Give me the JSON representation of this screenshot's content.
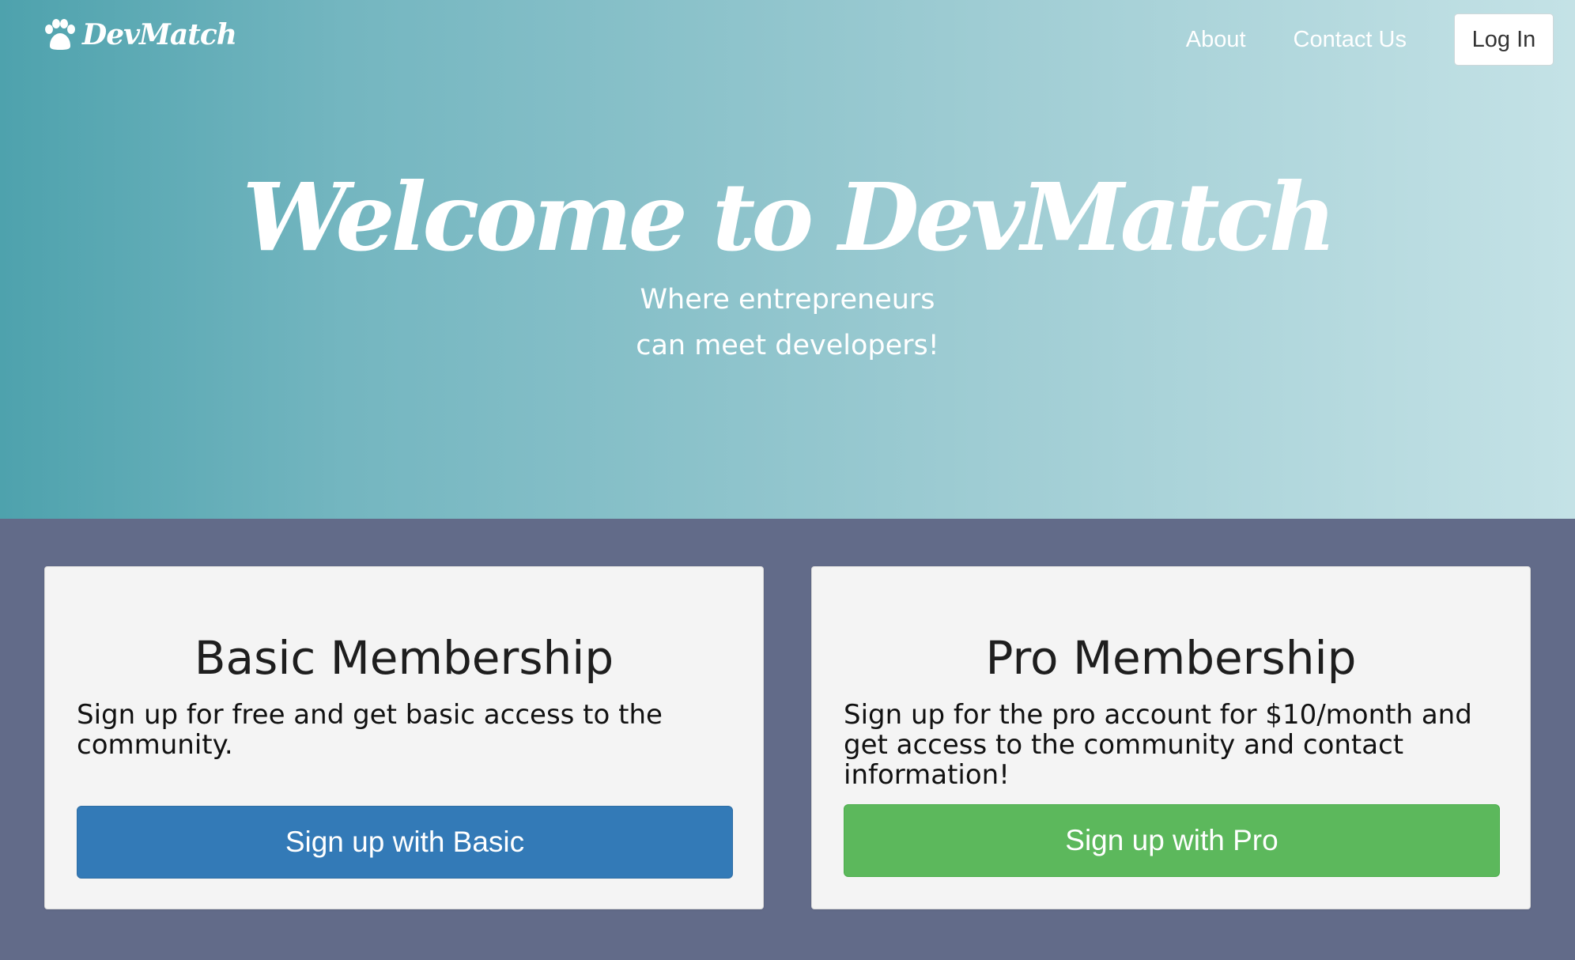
{
  "navbar": {
    "brand": "DevMatch",
    "brand_icon": "paw-icon",
    "links": [
      "About",
      "Contact Us"
    ],
    "login_label": "Log In"
  },
  "hero": {
    "title": "Welcome to DevMatch",
    "subtitle_line1": "Where entrepreneurs",
    "subtitle_line2": "can meet developers!"
  },
  "cards": {
    "basic": {
      "title": "Basic Membership",
      "description": "Sign up for free and get basic access to the community.",
      "button_label": "Sign up with Basic",
      "button_color": "#337ab7"
    },
    "pro": {
      "title": "Pro Membership",
      "description": "Sign up for the pro account for $10/month and get access to the community and contact information!",
      "button_label": "Sign up with Pro",
      "button_color": "#5cb85c"
    }
  },
  "colors": {
    "page_background": "#626b89",
    "hero_gradient_start": "#4ea2ad",
    "hero_gradient_end": "#c4e2e6",
    "card_background": "#f4f4f4"
  }
}
